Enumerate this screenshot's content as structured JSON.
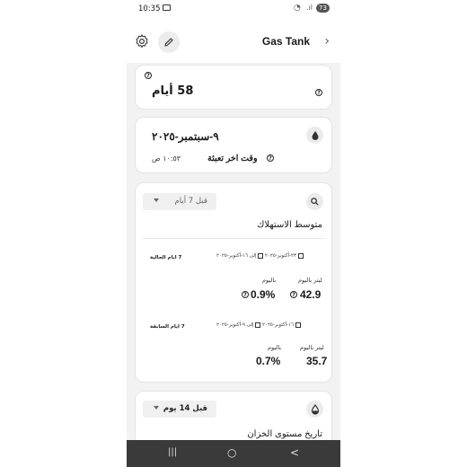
{
  "status": {
    "time": "10:35",
    "battery": "73"
  },
  "header": {
    "title": "Gas Tank",
    "settings_icon": "gear-icon",
    "edit_icon": "pencil-icon",
    "next_icon": "chevron-right-icon"
  },
  "days_card": {
    "value": "58 أيام",
    "info": "?"
  },
  "last_fill_card": {
    "date": "٩-سبتمبر-٢٠٢٥",
    "label": "وقت اخر تعبئة",
    "info": "?",
    "time": "١٠:٥٣ ص",
    "icon": "drop-icon"
  },
  "consumption_card": {
    "icon": "search-icon",
    "dropdown_value": "قبل 7 أيام",
    "title": "متوسط الاستهلاك",
    "current": {
      "label": "7 ايام الحالية",
      "from": "١٦-أكتوبر-٢٠٢٥",
      "to_word": "إلى",
      "to": "٢٣-أكتوبر-٢٠٢٥",
      "liters_label": "لیتر بالیوم",
      "liters_value": "42.9",
      "percent_label": "بالیوم",
      "percent_value": "0.9%",
      "info": "?"
    },
    "previous": {
      "label": "7 ايام السابقة",
      "from": "٩-أكتوبر-٢٠٢٥",
      "to_word": "إلى",
      "to": "١٦-أكتوبر-٢٠٢٥",
      "liters_label": "لیتر بالیوم",
      "liters_value": "35.7",
      "percent_label": "بالیوم",
      "percent_value": "0.7%"
    }
  },
  "history_card": {
    "icon": "tank-level-icon",
    "dropdown_value": "قبل 14 يوم",
    "title": "تاريخ مستوى الخزان"
  },
  "navbar": {
    "recents": "|||",
    "home": "○",
    "back": "<"
  }
}
